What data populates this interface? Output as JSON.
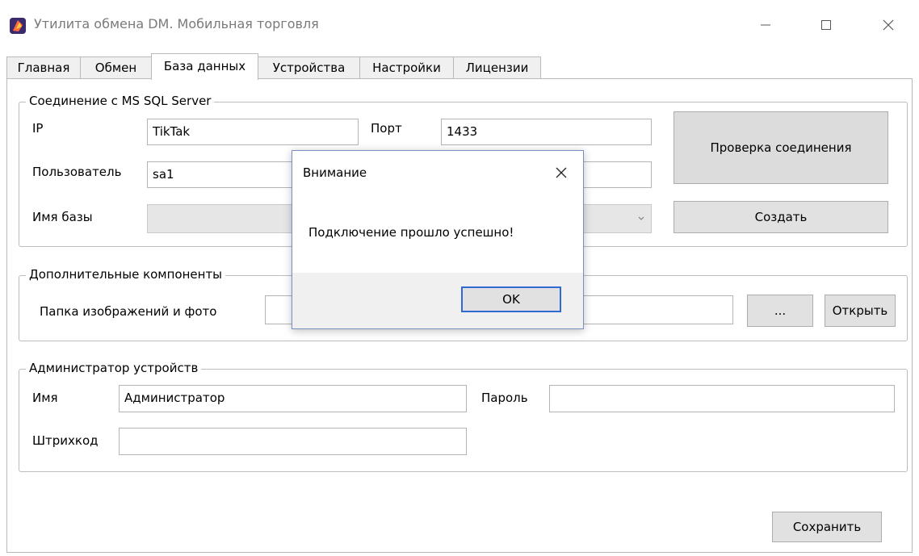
{
  "window": {
    "title": "Утилита обмена DM. Мобильная торговля"
  },
  "tabs": [
    {
      "label": "Главная",
      "active": false
    },
    {
      "label": "Обмен",
      "active": false
    },
    {
      "label": "База данных",
      "active": true
    },
    {
      "label": "Устройства",
      "active": false
    },
    {
      "label": "Настройки",
      "active": false
    },
    {
      "label": "Лицензии",
      "active": false
    }
  ],
  "sql": {
    "legend": "Соединение с MS SQL Server",
    "ip_label": "IP",
    "ip_value": "TikTak",
    "port_label": "Порт",
    "port_value": "1433",
    "user_label": "Пользователь",
    "user_value": "sa1",
    "db_label": "Имя базы",
    "test_button": "Проверка соединения",
    "create_button": "Создать"
  },
  "extra": {
    "legend": "Дополнительные компоненты",
    "folder_label": "Папка изображений и фото",
    "browse_button": "...",
    "open_button": "Открыть"
  },
  "admin": {
    "legend": "Администратор устройств",
    "name_label": "Имя",
    "name_value": "Администратор",
    "password_label": "Пароль",
    "barcode_label": "Штрихкод"
  },
  "save_button": "Сохранить",
  "dialog": {
    "title": "Внимание",
    "message": "Подключение прошло успешно!",
    "ok": "OK"
  },
  "colors": {
    "accent": "#2f6ad3",
    "button_bg": "#e1e1e1"
  }
}
